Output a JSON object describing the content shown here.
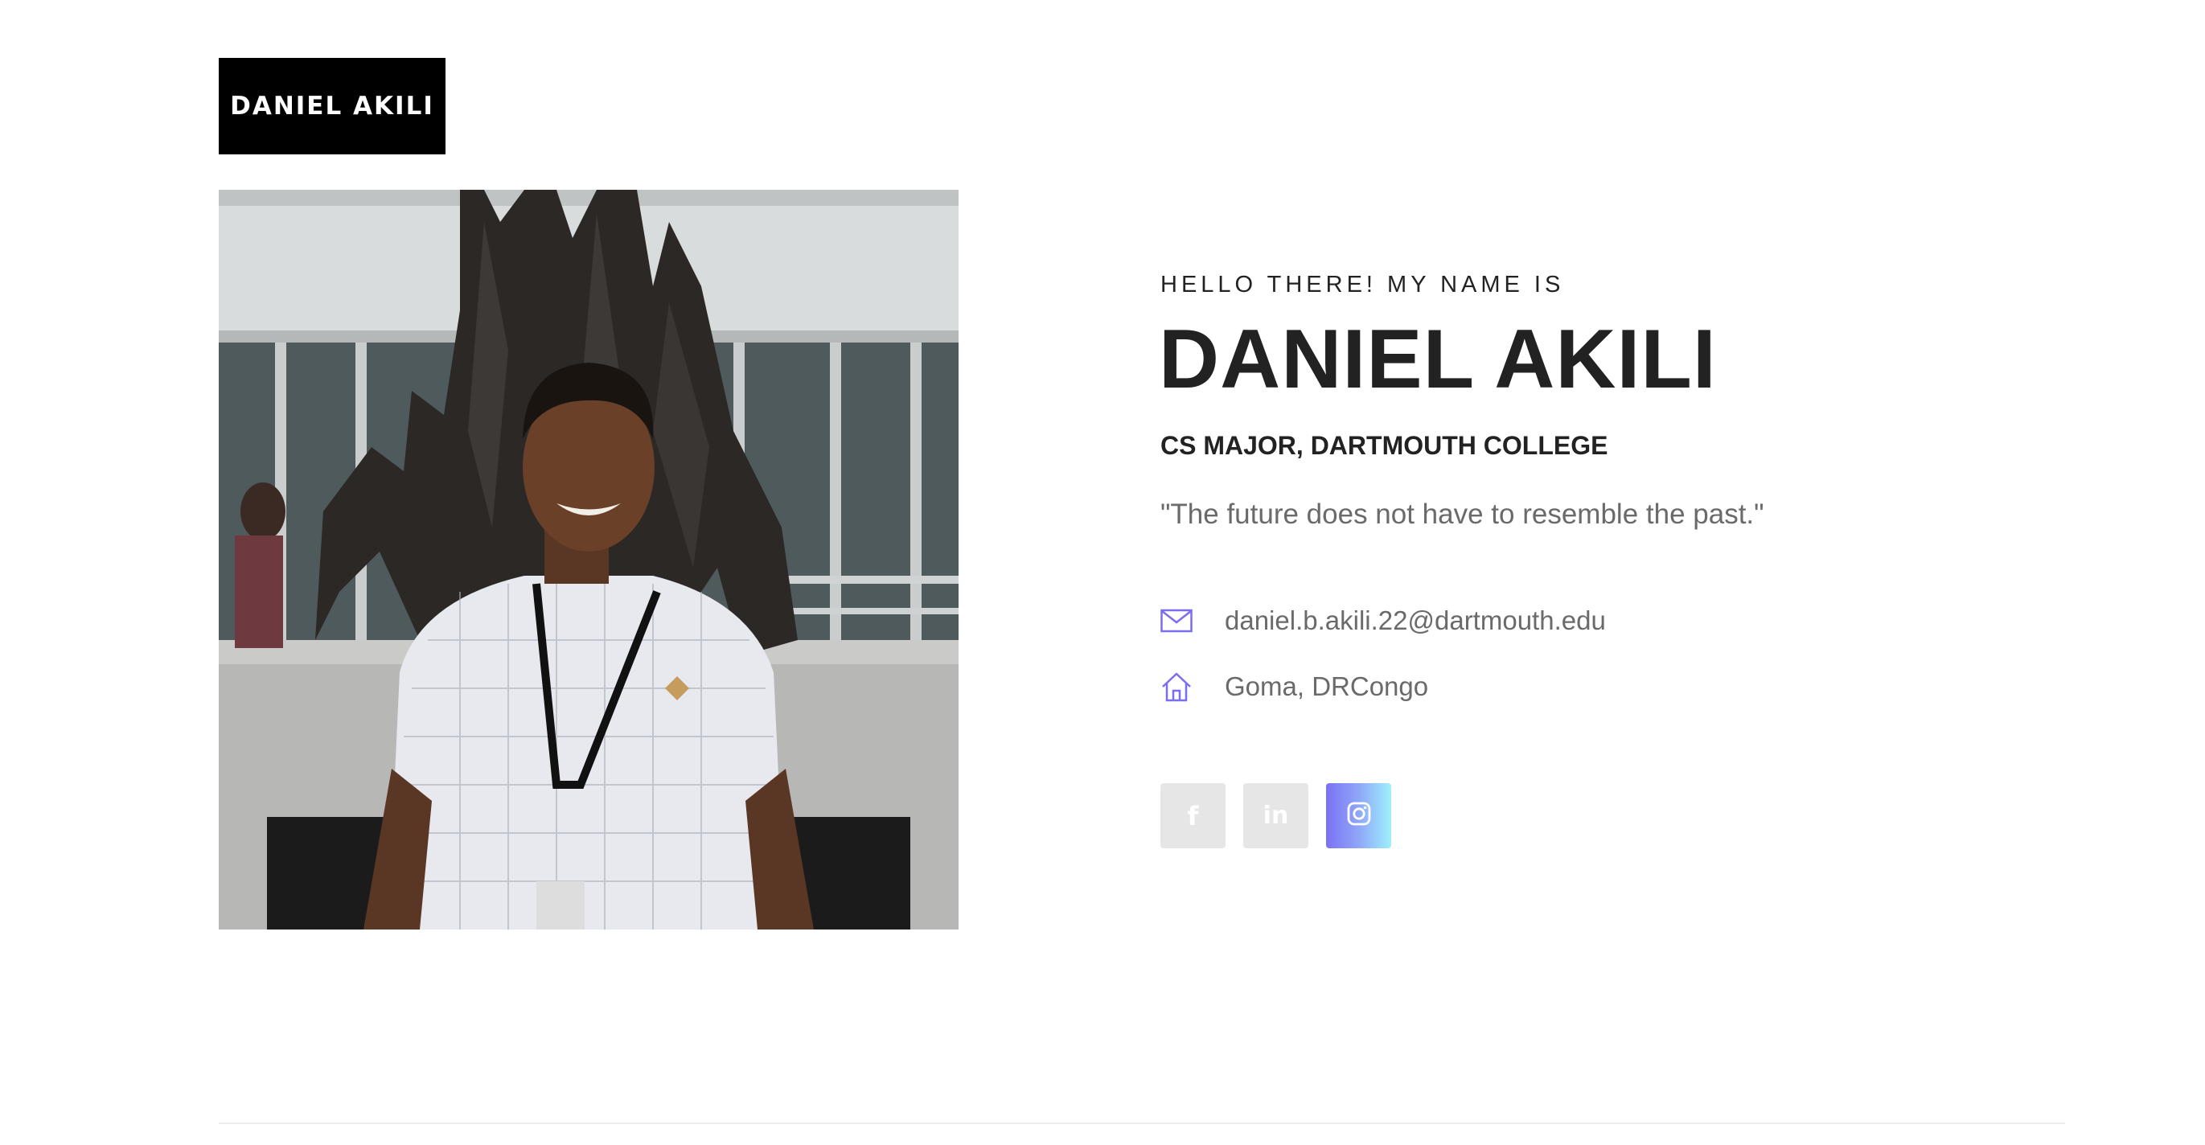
{
  "logo": {
    "text": "DANIEL AKILI"
  },
  "hero": {
    "greeting": "HELLO THERE! MY NAME IS",
    "name": "DANIEL AKILI",
    "role": "CS MAJOR, DARTMOUTH COLLEGE",
    "quote": "\"The future does not have to resemble the past.\""
  },
  "contact": {
    "email": {
      "icon": "mail-icon",
      "text": "daniel.b.akili.22@dartmouth.edu"
    },
    "address": {
      "icon": "home-icon",
      "text": "Goma, DRCongo"
    }
  },
  "socials": [
    {
      "name": "facebook",
      "icon": "facebook-icon",
      "glyph": "f",
      "active": false
    },
    {
      "name": "linkedin",
      "icon": "linkedin-icon",
      "glyph": "in",
      "active": false
    },
    {
      "name": "instagram",
      "icon": "instagram-icon",
      "glyph": "",
      "active": true
    }
  ],
  "colors": {
    "text_dark": "#222222",
    "text_muted": "#6a6a6a",
    "accent_icon": "#7b6cf0",
    "social_bg": "#e6e6e6",
    "gradient_start": "#7a72f4",
    "gradient_end": "#9ef0fb"
  }
}
